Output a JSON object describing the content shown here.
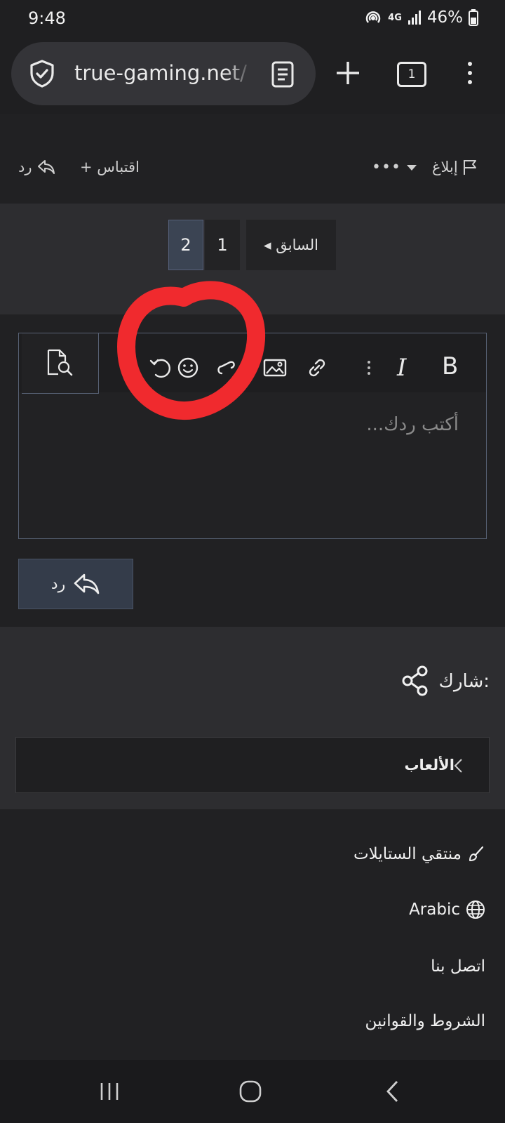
{
  "status_bar": {
    "time": "9:48",
    "network": "4G",
    "battery": "46%",
    "icons": [
      "hotspot-icon",
      "data-arrows-icon",
      "signal-icon",
      "battery-icon"
    ]
  },
  "browser": {
    "url": "true-gaming.net/",
    "tab_count": "1",
    "icons": [
      "shield-icon",
      "reader-mode-icon",
      "plus-icon",
      "more-vert-icon"
    ]
  },
  "post_actions": {
    "reply": "رد",
    "quote": "+ اقتباس",
    "more": "•••",
    "report": "إبلاغ"
  },
  "pagination": {
    "pages": [
      "2",
      "1"
    ],
    "current": "2",
    "previous": "◂ السابق"
  },
  "editor": {
    "placeholder": "أكتب ردك...",
    "tools": [
      "bold-icon",
      "italic-icon",
      "more-options-icon",
      "link-icon",
      "image-icon",
      "attachment-icon",
      "emoji-icon",
      "undo-icon",
      "preview-icon"
    ],
    "bold_label": "B",
    "italic_label": "I"
  },
  "reply_button": {
    "label": "رد"
  },
  "share": {
    "label": "شارك:"
  },
  "breadcrumb": {
    "label": "الألعاب"
  },
  "footer": {
    "style_chooser": "منتقي الستايلات",
    "language": "Arabic",
    "contact": "اتصل بنا",
    "terms": "الشروط والقوانين"
  },
  "colors": {
    "background": "#212123",
    "panel": "#2d2d30",
    "accent_page": "#3b4453",
    "annotation": "#f02a2e"
  }
}
